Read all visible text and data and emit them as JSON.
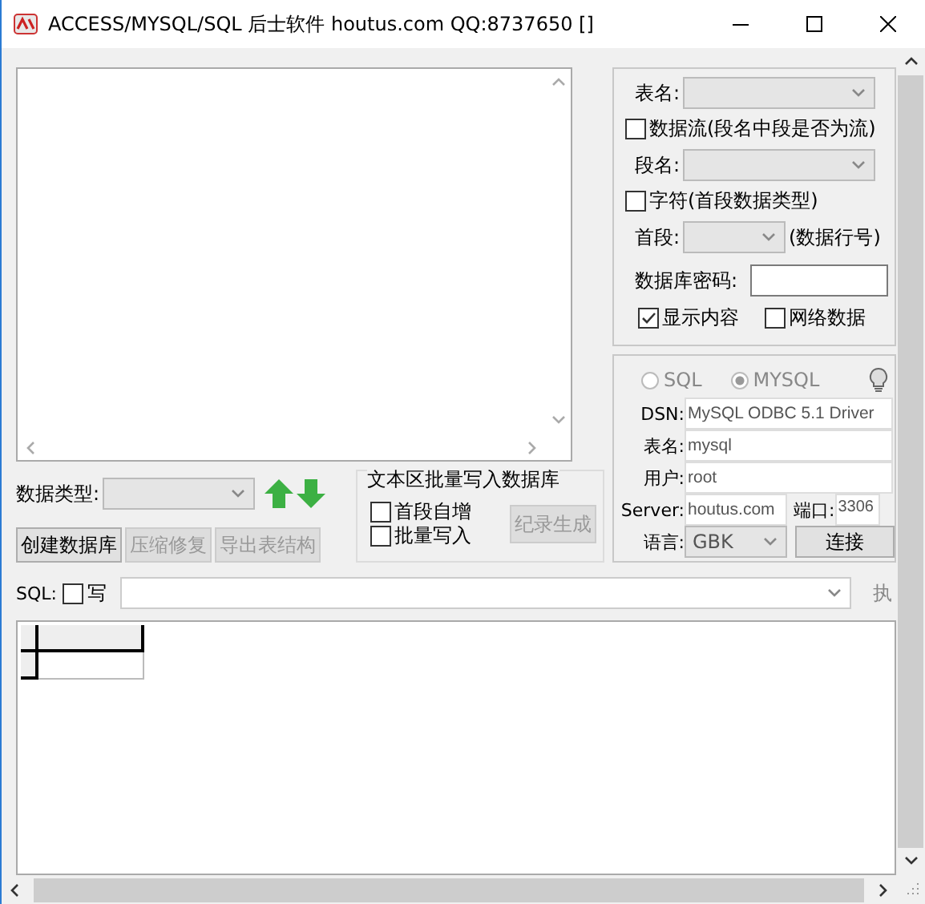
{
  "window": {
    "title": "ACCESS/MYSQL/SQL 后士软件 houtus.com QQ:8737650 []"
  },
  "data_type": {
    "label": "数据类型:"
  },
  "batch_group": {
    "title": "文本区批量写入数据库",
    "options": [
      {
        "label": "首段自增",
        "checked": false
      },
      {
        "label": "批量写入",
        "checked": false
      }
    ],
    "button": {
      "label": "纪录生成",
      "disabled": true
    }
  },
  "buttons": [
    {
      "label": "创建数据库",
      "disabled": false
    },
    {
      "label": "压缩修复",
      "disabled": true
    },
    {
      "label": "导出表结构",
      "disabled": true
    }
  ],
  "table_panel": {
    "table_label": "表名:",
    "stream": {
      "label": "数据流(段名中段是否为流)",
      "checked": false
    },
    "field_label": "段名:",
    "char": {
      "label": "字符(首段数据类型)",
      "checked": false
    },
    "first_label": "首段:",
    "row_label": "(数据行号)",
    "password_label": "数据库密码:",
    "options": [
      {
        "label": "显示内容",
        "checked": true
      },
      {
        "label": "网络数据",
        "checked": false
      }
    ]
  },
  "connection": {
    "modes": [
      {
        "label": "SQL",
        "selected": false,
        "disabled": true
      },
      {
        "label": "MYSQL",
        "selected": true,
        "disabled": true
      }
    ],
    "fields": [
      {
        "label": "DSN:",
        "value": "MySQL ODBC 5.1 Driver"
      },
      {
        "label": "表名:",
        "value": "mysql"
      },
      {
        "label": "用户:",
        "value": "root"
      }
    ],
    "server": {
      "label": "Server:",
      "value": "houtus.com"
    },
    "port": {
      "label": "端口:",
      "value": "3306"
    },
    "language": {
      "label": "语言:",
      "value": "GBK"
    },
    "connect_button": "连接"
  },
  "sql_bar": {
    "label": "SQL:",
    "write": {
      "label": "写",
      "checked": false
    },
    "execute": "执"
  }
}
